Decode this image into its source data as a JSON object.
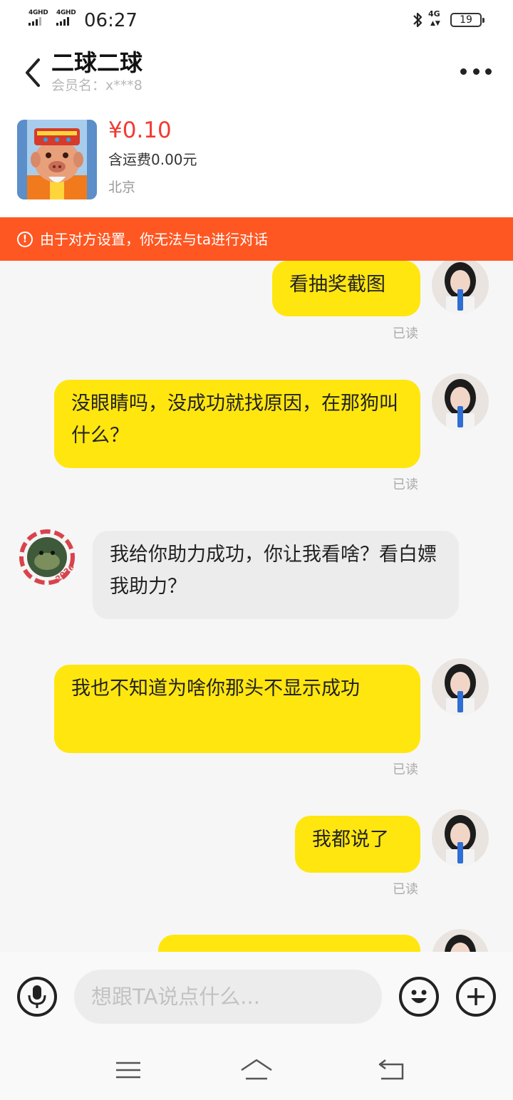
{
  "status_bar": {
    "net1": "4GHD",
    "net2": "4GHD",
    "time": "06:27",
    "net_right": "4G",
    "battery": "19"
  },
  "header": {
    "title": "二球二球",
    "subtitle": "会员名：x***8",
    "back_icon": "chevron-left-icon",
    "more_icon": "more-dots-icon"
  },
  "product": {
    "price": "¥0.10",
    "shipping": "含运费0.00元",
    "location": "北京"
  },
  "banner": {
    "icon": "!",
    "text": "由于对方设置，你无法与ta进行对话"
  },
  "messages": [
    {
      "from": "me",
      "text": "看抽奖截图",
      "status": "已读"
    },
    {
      "from": "me",
      "text": "没眼睛吗，没成功就找原因，在那狗叫什么？",
      "status": "已读"
    },
    {
      "from": "them",
      "text": "我给你助力成功，你让我看啥？看白嫖我助力？",
      "avatar_text": "2026"
    },
    {
      "from": "me",
      "text": "我也不知道为啥你那头不显示成功",
      "status": "已读"
    },
    {
      "from": "me",
      "text": "我都说了",
      "status": "已读"
    }
  ],
  "input": {
    "placeholder": "想跟TA说点什么..."
  },
  "colors": {
    "accent": "#ffe60f",
    "price": "#f23a32",
    "banner": "#ff5722",
    "received_bubble": "#ececec"
  }
}
